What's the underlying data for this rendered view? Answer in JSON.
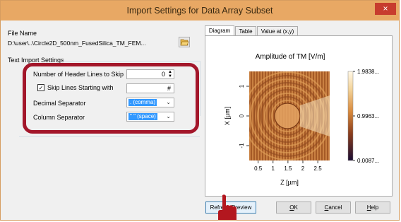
{
  "window": {
    "title": "Import Settings for Data Array Subset",
    "close_glyph": "×"
  },
  "file": {
    "label": "File Name",
    "path": "D:\\user\\..\\Circle2D_500nm_FusedSilica_TM_FEM...",
    "browse_icon": "folder-open-icon"
  },
  "text_import": {
    "group_label": "Text Import Settings",
    "header_lines_label": "Number of Header Lines to Skip",
    "header_lines_value": "0",
    "skip_lines_label": "Skip Lines Starting with",
    "skip_lines_checked": true,
    "skip_lines_value": "#",
    "decimal_separator_label": "Decimal Separator",
    "decimal_separator_value": ". (comma)",
    "column_separator_label": "Column Separator",
    "column_separator_value": "\" \" (space)"
  },
  "tabs": [
    {
      "label": "Diagram",
      "active": true
    },
    {
      "label": "Table",
      "active": false
    },
    {
      "label": "Value at (x,y)",
      "active": false
    }
  ],
  "chart_data": {
    "type": "heatmap",
    "title": "Amplitude of TM  [V/m]",
    "xlabel": "Z [µm]",
    "ylabel": "X [µm]",
    "x_ticks": [
      "0.5",
      "1",
      "1.5",
      "2",
      "2.5"
    ],
    "y_ticks": [
      "1",
      "0",
      "-1"
    ],
    "colorbar_ticks": [
      "1.9838...",
      "0.9963...",
      "0.0087..."
    ],
    "colorbar_range": [
      0.0087,
      1.9838
    ],
    "colormap": [
      "#1b0d33",
      "#5a2b1a",
      "#b8621f",
      "#e29a4a",
      "#f3d39a",
      "#fff8e6"
    ]
  },
  "buttons": {
    "refresh": "Refresh Preview",
    "ok_u": "O",
    "ok_rest": "K",
    "cancel_u": "C",
    "cancel_rest": "ancel",
    "help_u": "H",
    "help_rest": "elp"
  },
  "colors": {
    "highlight": "#a3162a",
    "title_bar": "#e8a864",
    "selection": "#3399ff"
  }
}
